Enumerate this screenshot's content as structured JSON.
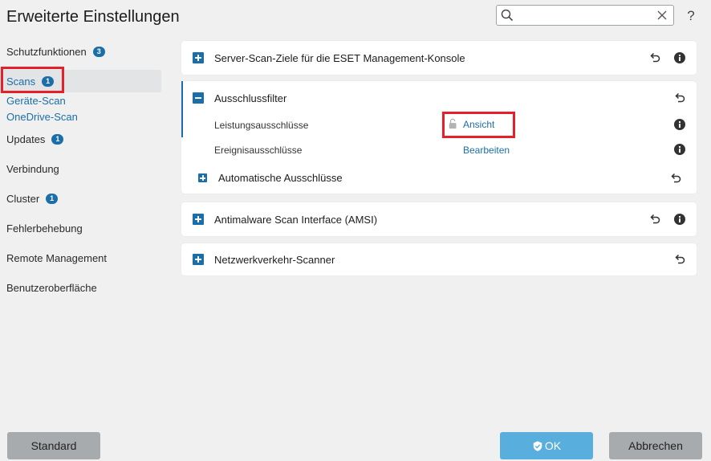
{
  "window": {
    "title": "Erweiterte Einstellungen",
    "help_label": "?"
  },
  "search": {
    "value": "",
    "placeholder": ""
  },
  "sidebar": {
    "items": [
      {
        "label": "Schutzfunktionen",
        "badge": "3"
      },
      {
        "label": "Scans",
        "badge": "1"
      },
      {
        "label": "Geräte-Scan"
      },
      {
        "label": "OneDrive-Scan"
      },
      {
        "label": "Updates",
        "badge": "1"
      },
      {
        "label": "Verbindung"
      },
      {
        "label": "Cluster",
        "badge": "1"
      },
      {
        "label": "Fehlerbehebung"
      },
      {
        "label": "Remote Management"
      },
      {
        "label": "Benutzeroberfläche"
      }
    ]
  },
  "main": {
    "sections": [
      {
        "title": "Server-Scan-Ziele für die ESET Management-Konsole"
      },
      {
        "title": "Ausschlussfilter",
        "rows": [
          {
            "label": "Leistungsausschlüsse",
            "action": "Ansicht"
          },
          {
            "label": "Ereignisausschlüsse",
            "action": "Bearbeiten"
          }
        ],
        "subsection": "Automatische Ausschlüsse"
      },
      {
        "title": "Antimalware Scan Interface (AMSI)"
      },
      {
        "title": "Netzwerkverkehr-Scanner"
      }
    ]
  },
  "footer": {
    "default_label": "Standard",
    "ok_label": "OK",
    "cancel_label": "Abbrechen"
  },
  "colors": {
    "accent": "#1b6ea8",
    "highlight": "#e5202a",
    "ok": "#58aedc"
  }
}
